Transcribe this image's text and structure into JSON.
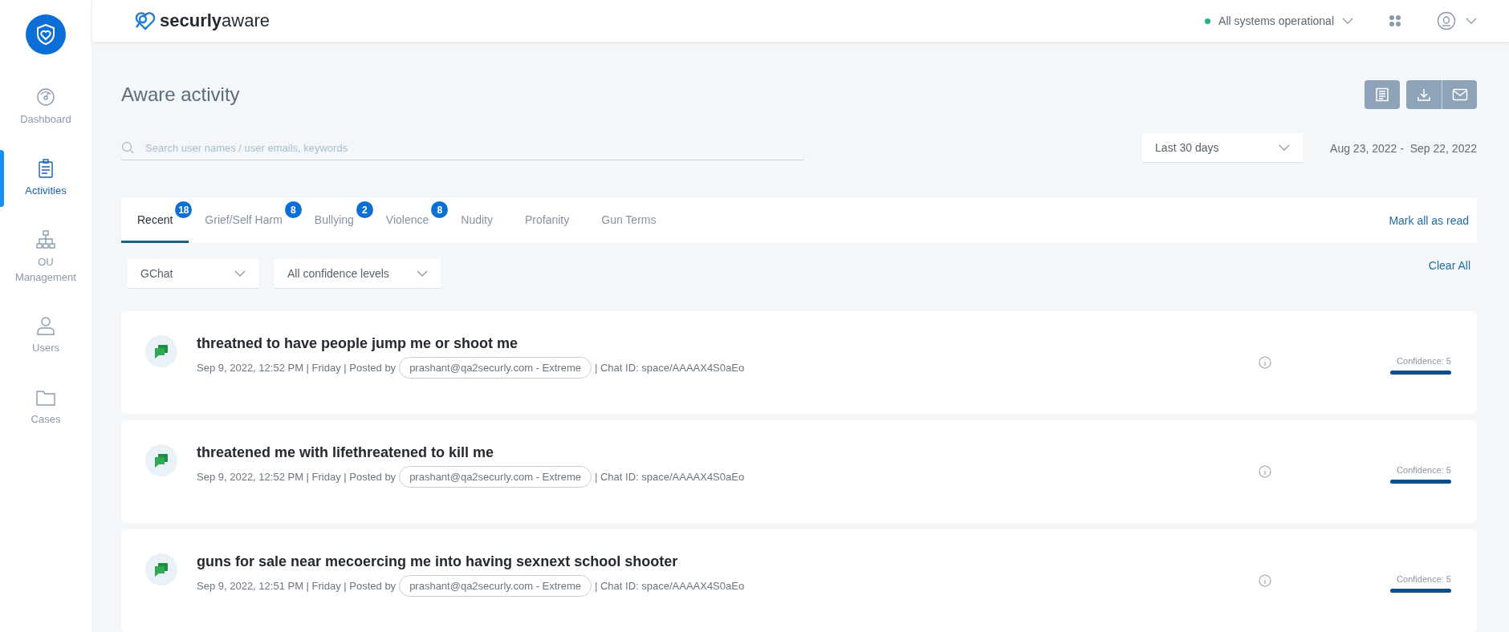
{
  "sidebar": {
    "items": [
      {
        "label": "Dashboard",
        "selected": false
      },
      {
        "label": "Activities",
        "selected": true
      },
      {
        "label": "OU Management",
        "selected": false
      },
      {
        "label": "Users",
        "selected": false
      },
      {
        "label": "Cases",
        "selected": false
      }
    ]
  },
  "header": {
    "brand_bold": "securly",
    "brand_light": "aware",
    "status": "All systems operational"
  },
  "page": {
    "title": "Aware activity",
    "search": {
      "placeholder": "Search user names / user emails, keywords"
    },
    "date_range": {
      "value": "Last 30 days"
    },
    "dates": "Aug 23, 2022 -  Sep 22, 2022"
  },
  "tabs": [
    {
      "label": "Recent",
      "badge": "18",
      "selected": true
    },
    {
      "label": "Grief/Self Harm",
      "badge": "8",
      "selected": false
    },
    {
      "label": "Bullying",
      "badge": "2",
      "selected": false
    },
    {
      "label": "Violence",
      "badge": "8",
      "selected": false
    },
    {
      "label": "Nudity",
      "selected": false
    },
    {
      "label": "Profanity",
      "selected": false
    },
    {
      "label": "Gun Terms",
      "selected": false
    }
  ],
  "mark_all": "Mark all as read",
  "filters": [
    {
      "value": "GChat"
    },
    {
      "value": "All confidence levels"
    }
  ],
  "clear_all": "Clear All",
  "activities": [
    {
      "title": "threatned to have people jump me or shoot me",
      "meta": "Sep 9, 2022, 12:52 PM | Friday | Posted by",
      "poster": "prashant@qa2securly.com - Extreme",
      "chat": "| Chat ID: space/AAAAX4S0aEo",
      "confidence": "Confidence: 5",
      "level": 1
    },
    {
      "title": "threatened me with lifethreatened to kill me",
      "meta": "Sep 9, 2022, 12:52 PM | Friday | Posted by",
      "poster": "prashant@qa2securly.com - Extreme",
      "chat": "| Chat ID: space/AAAAX4S0aEo",
      "confidence": "Confidence: 5",
      "level": 1
    },
    {
      "title": "guns for sale near mecoercing me into having sexnext school shooter",
      "meta": "Sep 9, 2022, 12:51 PM | Friday | Posted by",
      "poster": "prashant@qa2securly.com - Extreme",
      "chat": "| Chat ID: space/AAAAX4S0aEo",
      "confidence": "Confidence: 5",
      "level": 1
    }
  ]
}
